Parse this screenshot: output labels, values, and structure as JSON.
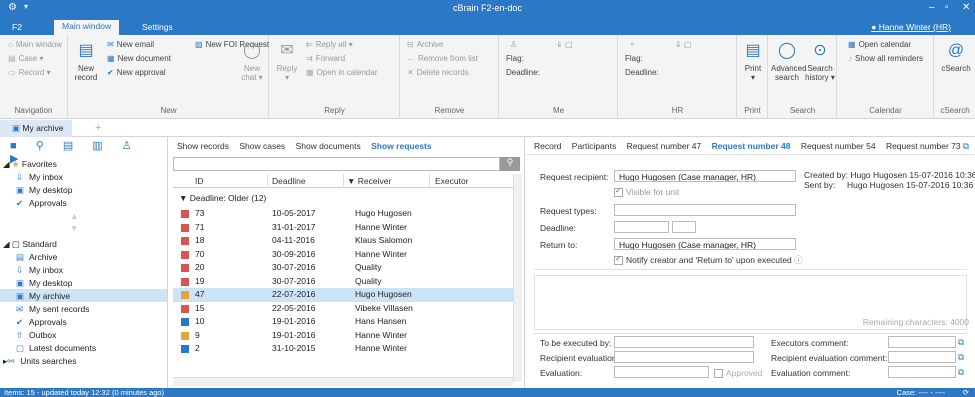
{
  "window": {
    "title": "cBrain F2-en-doc"
  },
  "ribbon_tabs": [
    {
      "label": "F2"
    },
    {
      "label": "Main window"
    },
    {
      "label": "Settings"
    }
  ],
  "user": {
    "name": "Hanne Winter (HR)"
  },
  "ribbon": {
    "navigation": {
      "label": "Navigation",
      "items": [
        "Main window",
        "Case",
        "Record"
      ]
    },
    "new": {
      "label": "New",
      "new_record": "New\nrecord",
      "email": "New email",
      "document": "New document",
      "approval": "New approval",
      "foi": "New FOI Request",
      "chat": "New\nchat"
    },
    "reply": {
      "label": "Reply",
      "reply": "Reply",
      "reply_all": "Reply all",
      "forward": "Forward",
      "open_calendar": "Open in calendar"
    },
    "remove": {
      "label": "Remove",
      "archive": "Archive",
      "remove_from_list": "Remove from list",
      "delete_records": "Delete records"
    },
    "me": {
      "label": "Me",
      "flag": "Flag:",
      "deadline": "Deadline:"
    },
    "hr": {
      "label": "HR",
      "flag": "Flag:",
      "deadline": "Deadline:"
    },
    "print": {
      "label": "Print",
      "btn": "Print"
    },
    "search": {
      "label": "Search",
      "advanced": "Advanced\nsearch",
      "history": "Search\nhistory"
    },
    "calendar": {
      "label": "Calendar",
      "open": "Open calendar",
      "reminders": "Show all reminders"
    },
    "csearch": {
      "label": "cSearch",
      "btn": "cSearch"
    }
  },
  "nav_tab": {
    "label": "My archive"
  },
  "tree": {
    "favorites": "Favorites",
    "fav_items": [
      "My inbox",
      "My desktop",
      "Approvals"
    ],
    "standard": "Standard",
    "std_items": [
      "Archive",
      "My inbox",
      "My desktop",
      "My archive",
      "My sent records",
      "Approvals",
      "Outbox",
      "Latest documents"
    ],
    "units": "Units searches"
  },
  "list_tabs": [
    "Show records",
    "Show cases",
    "Show documents",
    "Show requests"
  ],
  "columns": {
    "id": "ID",
    "deadline": "Deadline",
    "receiver": "Receiver",
    "executor": "Executor"
  },
  "group": "Deadline: Older (12)",
  "rows": [
    {
      "id": "73",
      "deadline": "10-05-2017",
      "receiver": "Hugo Hugosen",
      "ico": "#d9534f"
    },
    {
      "id": "71",
      "deadline": "31-01-2017",
      "receiver": "Hanne Winter",
      "ico": "#d9534f"
    },
    {
      "id": "18",
      "deadline": "04-11-2016",
      "receiver": "Klaus Salomon",
      "ico": "#d9534f"
    },
    {
      "id": "70",
      "deadline": "30-09-2016",
      "receiver": "Hanne Winter",
      "ico": "#d9534f"
    },
    {
      "id": "20",
      "deadline": "30-07-2016",
      "receiver": "Quality",
      "ico": "#d9534f"
    },
    {
      "id": "19",
      "deadline": "30-07-2016",
      "receiver": "Quality",
      "ico": "#d9534f"
    },
    {
      "id": "47",
      "deadline": "22-07-2016",
      "receiver": "Hugo Hugosen",
      "ico": "#e8a33d"
    },
    {
      "id": "15",
      "deadline": "22-05-2016",
      "receiver": "Vibeke Villasen",
      "ico": "#d9534f"
    },
    {
      "id": "10",
      "deadline": "19-01-2016",
      "receiver": "Hans Hansen",
      "ico": "#2b79c6"
    },
    {
      "id": "9",
      "deadline": "19-01-2016",
      "receiver": "Hanne Winter",
      "ico": "#e8a33d"
    },
    {
      "id": "2",
      "deadline": "31-10-2015",
      "receiver": "Hanne Winter",
      "ico": "#2b79c6"
    }
  ],
  "detail_tabs": [
    "Record",
    "Participants",
    "Request number 47",
    "Request number 48",
    "Request number 54",
    "Request number 73"
  ],
  "detail": {
    "recipient_label": "Request recipient:",
    "recipient": "Hugo Hugosen (Case manager, HR)",
    "visible": "Visible for unit",
    "types_label": "Request types:",
    "deadline_label": "Deadline:",
    "return_label": "Return to:",
    "return_value": "Hugo Hugosen (Case manager, HR)",
    "notify": "Notify creator and 'Return to' upon executed",
    "created_label": "Created by:",
    "created_by": "Hugo Hugosen",
    "created_at": "15-07-2016 10:36",
    "sent_label": "Sent by:",
    "sent_by": "Hugo Hugosen",
    "sent_at": "15-07-2016 10:36",
    "remaining": "Remaining characters: 4000",
    "exec_by": "To be executed by:",
    "rec_eval": "Recipient evaluation:",
    "evaluation": "Evaluation:",
    "approved": "Approved",
    "exec_comment": "Executors comment:",
    "rec_eval_comment": "Recipient evaluation comment:",
    "eval_comment": "Evaluation comment:"
  },
  "status": {
    "left": "Items: 15 - updated today 12:32 (0 minutes ago)",
    "right": "Case: ---- - ----"
  }
}
